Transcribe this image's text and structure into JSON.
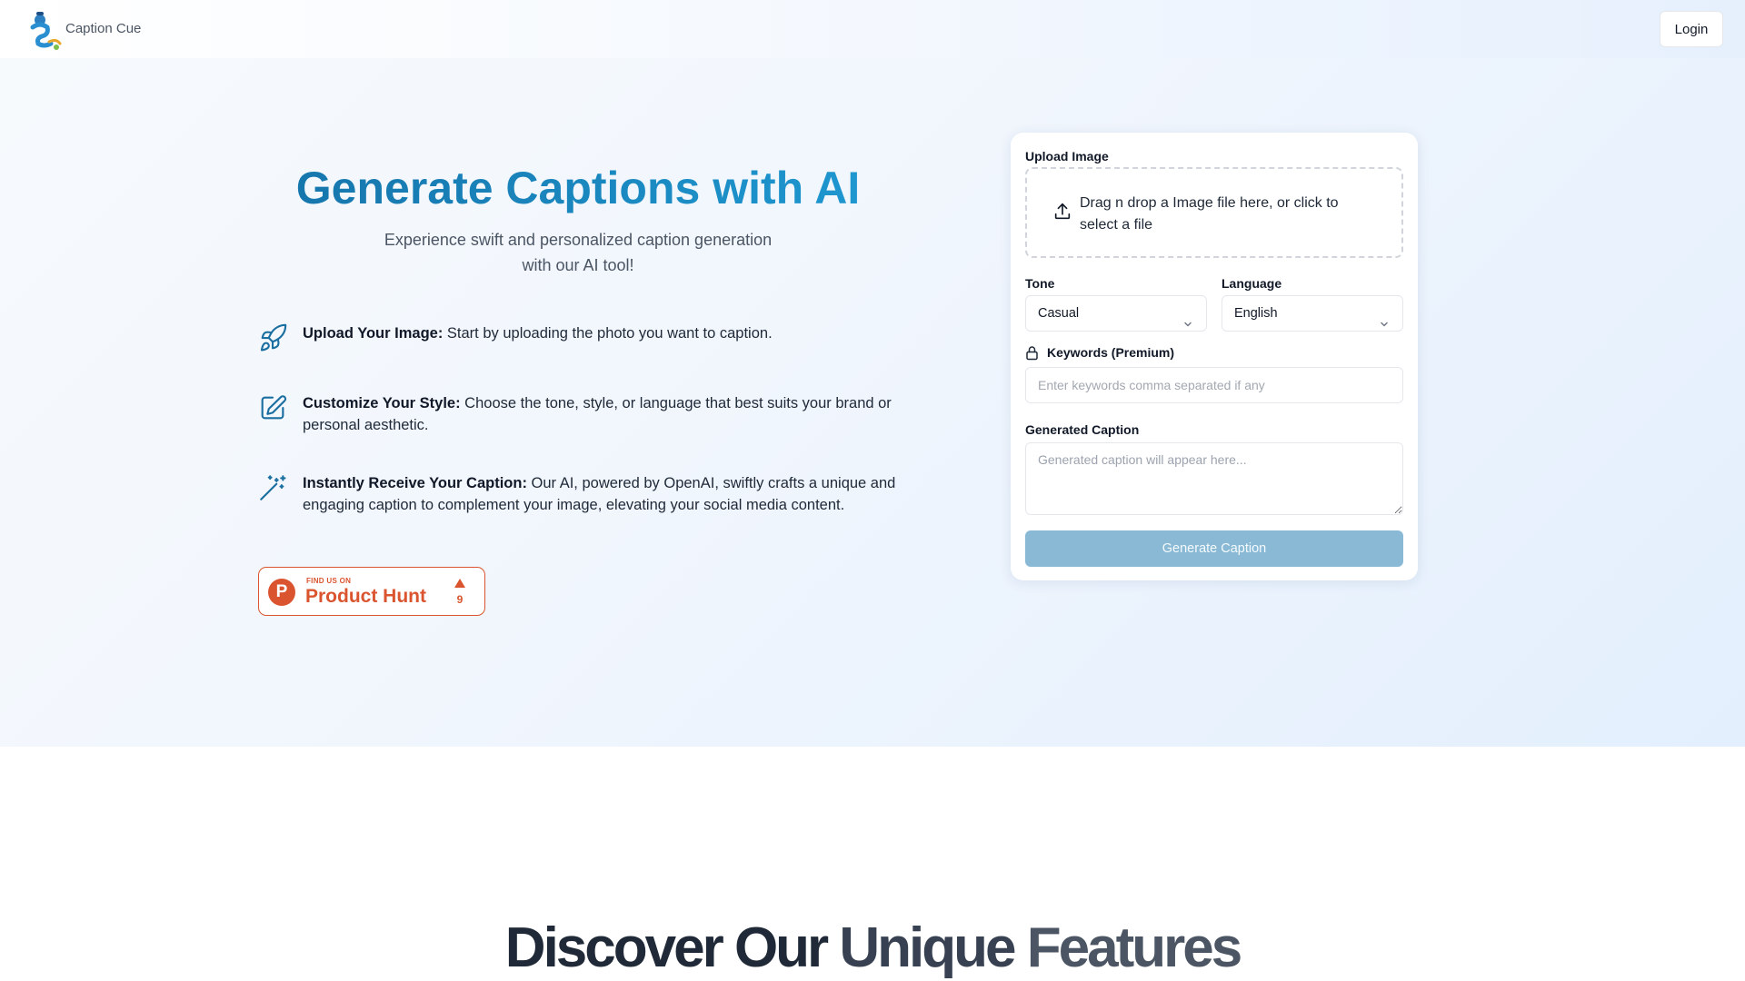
{
  "navbar": {
    "brand": "Caption Cue",
    "login_label": "Login"
  },
  "hero": {
    "title": "Generate Captions with AI",
    "subtitle_line1": "Experience swift and personalized caption generation",
    "subtitle_line2": "with our AI tool!"
  },
  "features": [
    {
      "icon": "rocket-icon",
      "title": "Upload Your Image:",
      "text": " Start by uploading the photo you want to caption."
    },
    {
      "icon": "edit-icon",
      "title": "Customize Your Style:",
      "text": " Choose the tone, style, or language that best suits your brand or personal aesthetic."
    },
    {
      "icon": "magic-wand-icon",
      "title": "Instantly Receive Your Caption:",
      "text": " Our AI, powered by OpenAI, swiftly crafts a unique and engaging caption to complement your image, elevating your social media content."
    }
  ],
  "product_hunt": {
    "find_us": "FIND US ON",
    "name": "Product Hunt",
    "letter": "P",
    "upvotes": "9",
    "color": "#da552f"
  },
  "form": {
    "upload_label": "Upload Image",
    "dropzone_text": "Drag n drop a Image file here, or click to select a file",
    "tone_label": "Tone",
    "tone_value": "Casual",
    "language_label": "Language",
    "language_value": "English",
    "keywords_label": "Keywords (Premium)",
    "keywords_placeholder": "Enter keywords comma separated if any",
    "caption_label": "Generated Caption",
    "caption_placeholder": "Generated caption will appear here...",
    "generate_label": "Generate Caption",
    "button_color": "#89b9d5"
  },
  "discover": {
    "word1": "Discover ",
    "word2": "Our ",
    "word3": "Unique ",
    "word4": "Features"
  },
  "colors": {
    "title_gradient_start": "#1572a8",
    "title_gradient_end": "#1f9bd4",
    "icon_color": "#1a6ea0"
  }
}
